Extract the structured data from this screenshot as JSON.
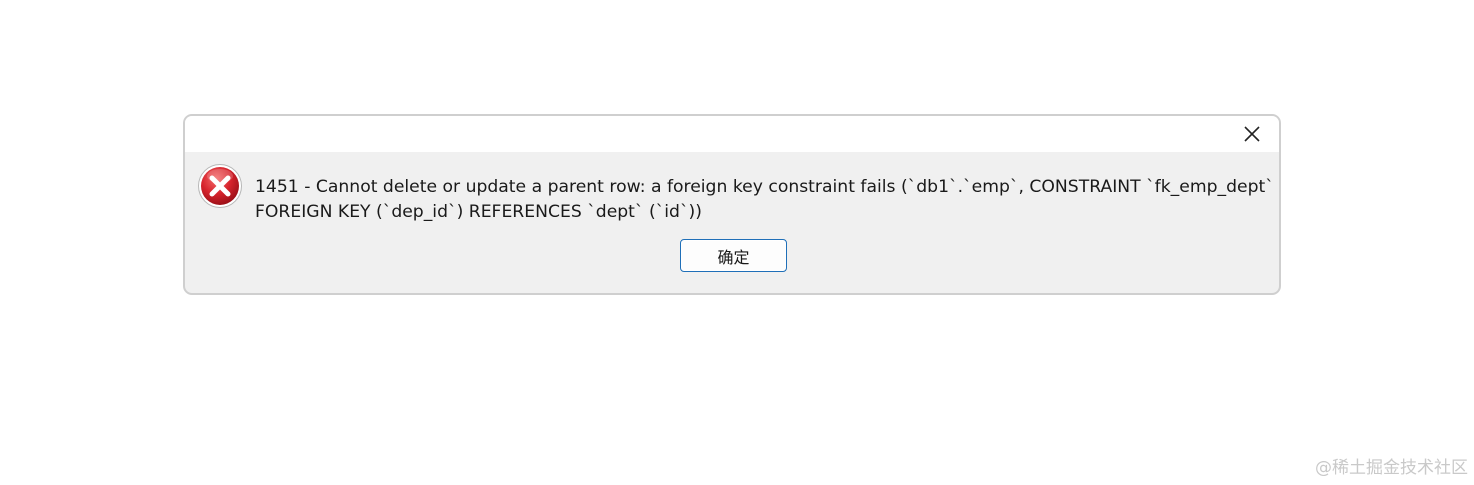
{
  "dialog": {
    "close_icon": "close-icon",
    "error_icon": "error-icon",
    "message_lines": [
      "1451 - Cannot delete or update a parent row: a foreign key constraint fails (`db1`.`emp`, CONSTRAINT `fk_emp_dept`",
      "FOREIGN KEY (`dep_id`) REFERENCES `dept` (`id`))"
    ],
    "ok_label": "确定"
  },
  "watermark": "@稀土掘金技术社区",
  "colors": {
    "dialog_background": "#f0f0f0",
    "titlebar_background": "#ffffff",
    "button_border": "#1f6fb8",
    "error_red": "#d6232c"
  }
}
